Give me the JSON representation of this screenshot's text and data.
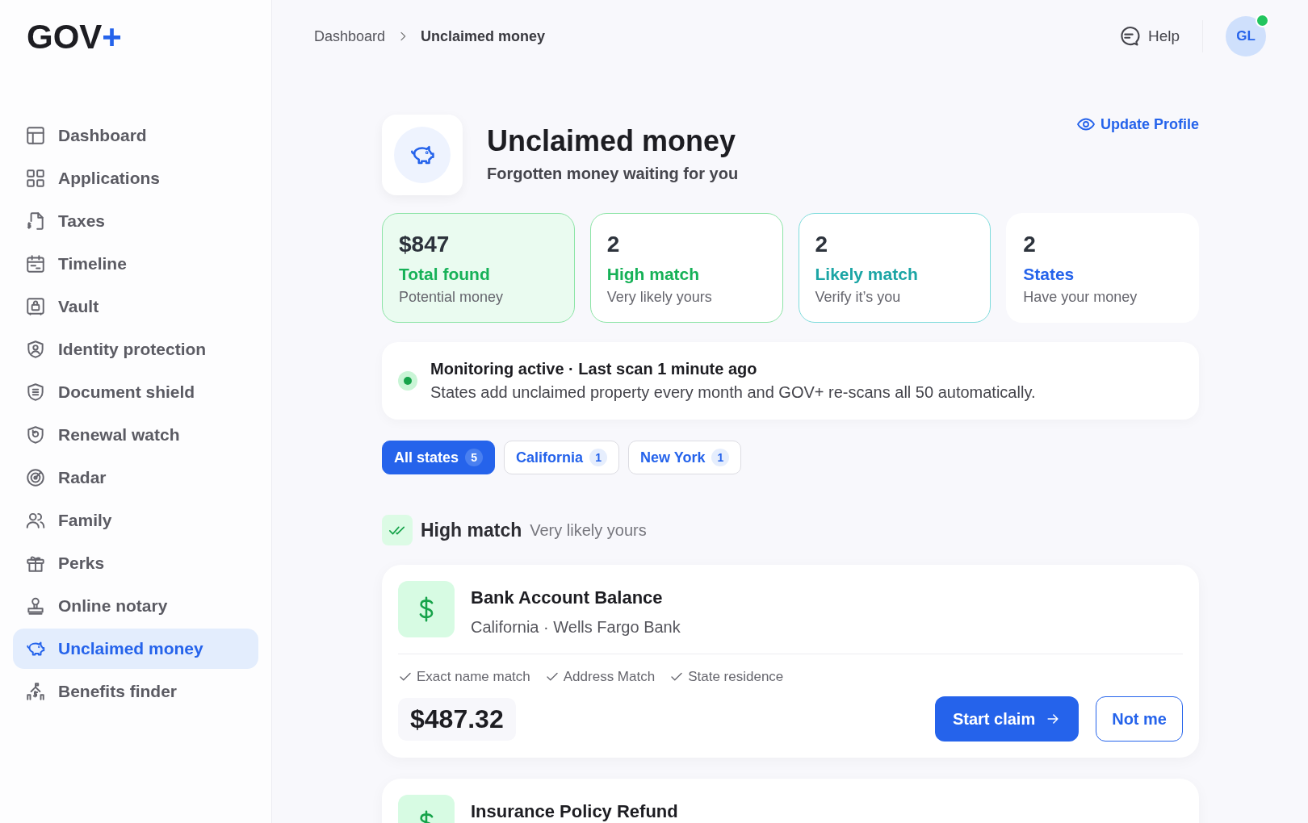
{
  "logo": {
    "text": "GOV",
    "mark": "+"
  },
  "sidebar": {
    "items": [
      {
        "label": "Dashboard",
        "selected": false
      },
      {
        "label": "Applications",
        "selected": false
      },
      {
        "label": "Taxes",
        "selected": false
      },
      {
        "label": "Timeline",
        "selected": false
      },
      {
        "label": "Vault",
        "selected": false
      },
      {
        "label": "Identity protection",
        "selected": false
      },
      {
        "label": "Document shield",
        "selected": false
      },
      {
        "label": "Renewal watch",
        "selected": false
      },
      {
        "label": "Radar",
        "selected": false
      },
      {
        "label": "Family",
        "selected": false
      },
      {
        "label": "Perks",
        "selected": false
      },
      {
        "label": "Online notary",
        "selected": false
      },
      {
        "label": "Unclaimed money",
        "selected": true
      },
      {
        "label": "Benefits finder",
        "selected": false
      }
    ]
  },
  "breadcrumb": [
    "Dashboard",
    "Unclaimed money"
  ],
  "header": {
    "help": "Help",
    "avatar": "GL",
    "online": true
  },
  "page": {
    "title": "Unclaimed money",
    "subtitle": "Forgotten money waiting for you",
    "action": "Update Profile"
  },
  "stats": [
    {
      "kind": "total",
      "value": "$847",
      "label": "Total found",
      "caption": "Potential money"
    },
    {
      "kind": "high",
      "value": "2",
      "label": "High match",
      "caption": "Very likely yours"
    },
    {
      "kind": "likely",
      "value": "2",
      "label": "Likely match",
      "caption": "Verify it’s you"
    },
    {
      "kind": "states",
      "value": "2",
      "label": "States",
      "caption": "Have your money"
    }
  ],
  "monitor": {
    "active": true,
    "title": "Monitoring active · Last scan 1 minute ago",
    "text": "States add unclaimed property every month and GOV+ re-scans all 50 automatically."
  },
  "filters": [
    {
      "label": "All states",
      "count": "5",
      "selected": true
    },
    {
      "label": "California",
      "count": "1",
      "selected": false
    },
    {
      "label": "New York",
      "count": "1",
      "selected": false
    }
  ],
  "section": {
    "title": "High match",
    "caption": "Very likely yours"
  },
  "claims": [
    {
      "title": "Bank Account Balance",
      "meta": "California · Wells Fargo Bank",
      "checks": [
        "Exact name match",
        "Address Match",
        "State residence"
      ],
      "amount": "$487.32",
      "primary": "Start claim",
      "secondary": "Not me"
    },
    {
      "title": "Insurance Policy Refund"
    }
  ]
}
